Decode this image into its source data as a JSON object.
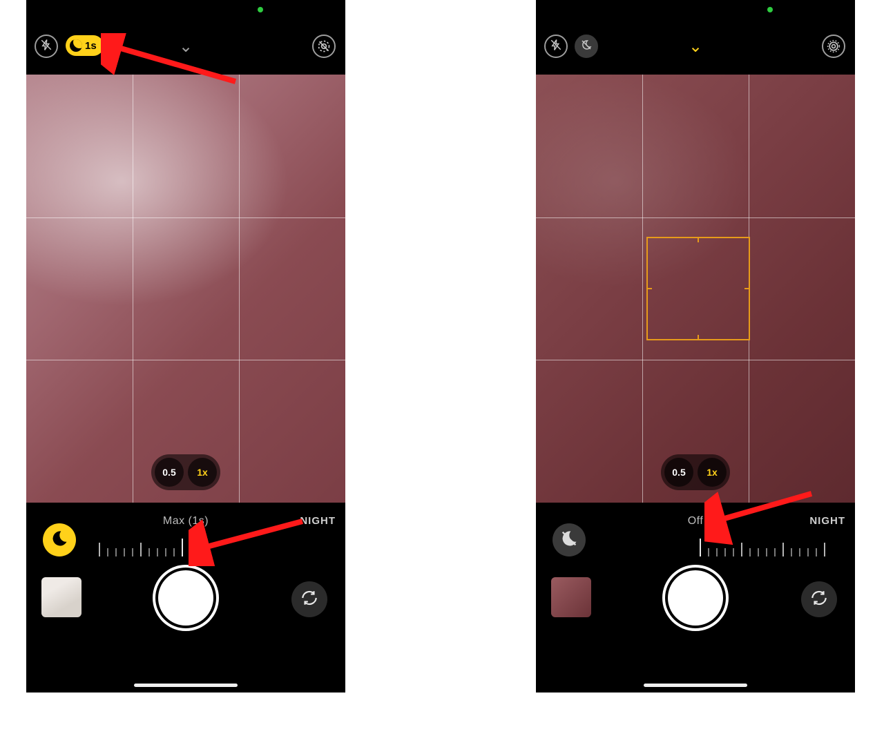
{
  "colors": {
    "yellow": "#ffce00",
    "accent_arrow": "#ff1a1a",
    "focus_box": "#e79b1a"
  },
  "left": {
    "night_badge_duration": "1s",
    "zoom": {
      "wide": "0.5",
      "main": "1x",
      "active": "1x"
    },
    "night_mode_status": "Max (1s)",
    "mode_label": "NIGHT",
    "night_toggle_state": "on"
  },
  "right": {
    "zoom": {
      "wide": "0.5",
      "main": "1x",
      "active": "1x"
    },
    "night_mode_status": "Off",
    "mode_label": "NIGHT",
    "night_toggle_state": "off"
  },
  "chevron_glyph": "⌄"
}
